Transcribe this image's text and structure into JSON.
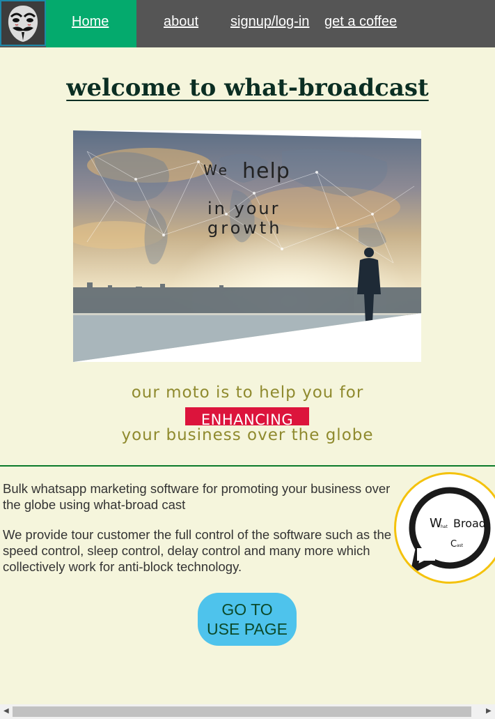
{
  "nav": {
    "logo": "anonymous-mask-icon",
    "items": [
      {
        "label": "Home",
        "active": true
      },
      {
        "label": "about"
      },
      {
        "label": "signup/log-in"
      },
      {
        "label": "get a coffee"
      }
    ]
  },
  "title": "welcome to what-broadcast",
  "banner": {
    "line1_small": "We",
    "line1_big": "help",
    "line2": "in your",
    "line3": "growth"
  },
  "moto": {
    "line1": "our moto is to help you for",
    "highlight": "ENHANCING",
    "line2": "your business over the globe"
  },
  "content": {
    "paragraph1": "Bulk whatsapp marketing software for promoting your business over the globe using what-broad cast",
    "paragraph2": "We provide tour customer the full control of the software such as the speed control, sleep control, delay control and many more which collectively work for anti-block technology."
  },
  "circle_logo": {
    "w": "W",
    "hat": "hat",
    "broad": "Broad",
    "c": "C",
    "ast": "ast"
  },
  "cta": {
    "line1": "GO TO",
    "line2": "USE PAGE"
  },
  "colors": {
    "nav_bg": "#555555",
    "active_tab": "#04aa6d",
    "page_bg": "#f5f5dc",
    "accent_red": "#dc143c",
    "button": "#4ec3ec",
    "logo_ring": "#f4c20d"
  }
}
